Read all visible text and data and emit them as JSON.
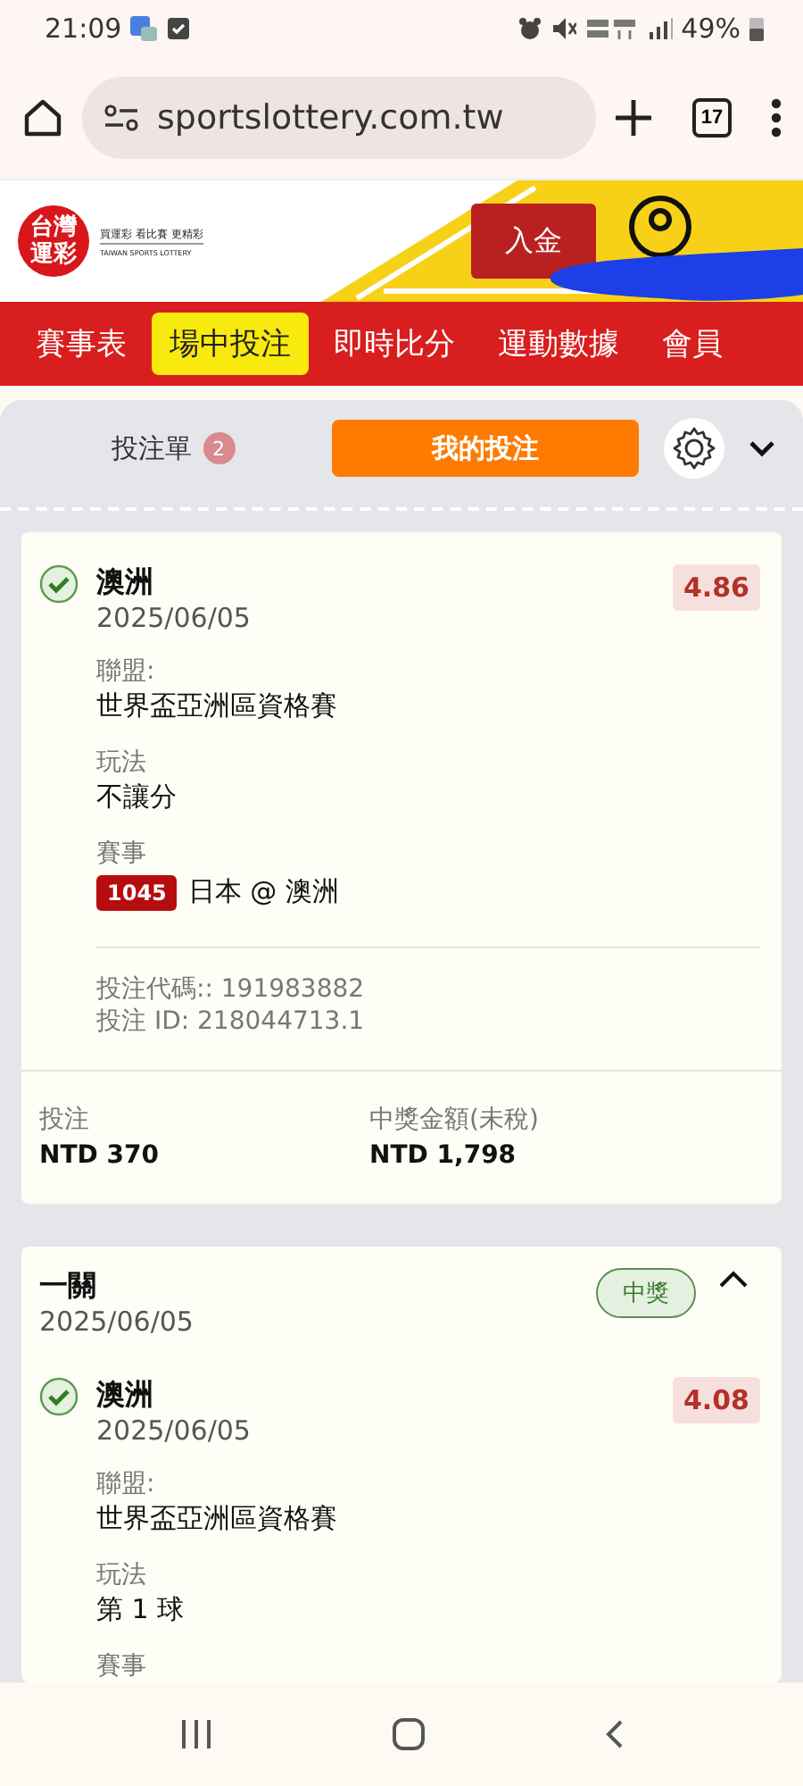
{
  "status_bar": {
    "time": "21:09",
    "battery": "49%"
  },
  "browser": {
    "url": "sportslottery.com.tw",
    "tab_count": "17"
  },
  "site_header": {
    "logo": "台灣運彩",
    "tagline": "買運彩 看比賽 更精彩",
    "tagline_en": "TAIWAN SPORTS LOTTERY",
    "deposit_button": "入金"
  },
  "nav": [
    {
      "label": "賽事表",
      "selected": false
    },
    {
      "label": "場中投注",
      "selected": true
    },
    {
      "label": "即時比分",
      "selected": false
    },
    {
      "label": "運動數據",
      "selected": false
    },
    {
      "label": "會員",
      "selected": false
    }
  ],
  "bet_panel": {
    "expanded": true,
    "tabs": [
      {
        "label": "投注單",
        "badge": "2",
        "selected": false
      },
      {
        "label": "我的投注",
        "selected": true
      }
    ]
  },
  "bets": [
    {
      "kind": "single",
      "selections": [
        {
          "team": "澳洲",
          "date": "2025/06/05",
          "odds": "4.86",
          "checked": true,
          "fields": [
            {
              "label": "聯盟:",
              "value": "世界盃亞洲區資格賽"
            },
            {
              "label": "玩法",
              "value": "不讓分"
            },
            {
              "label": "賽事",
              "code": "1045",
              "value": "日本 @ 澳洲"
            }
          ]
        }
      ],
      "refs": [
        "投注代碼:: 191983882",
        "投注 ID: 218044713.1"
      ],
      "stake_label": "投注",
      "stake": "NTD 370",
      "payout_label": "中獎金額(未稅)",
      "payout": "NTD 1,798"
    },
    {
      "kind": "parlay",
      "title": "一關",
      "date": "2025/06/05",
      "status": "中獎",
      "expanded": true,
      "selections": [
        {
          "team": "澳洲",
          "date": "2025/06/05",
          "odds": "4.08",
          "checked": true,
          "fields": [
            {
              "label": "聯盟:",
              "value": "世界盃亞洲區資格賽"
            },
            {
              "label": "玩法",
              "value": "第 1 球"
            },
            {
              "label": "賽事"
            }
          ]
        }
      ]
    }
  ]
}
